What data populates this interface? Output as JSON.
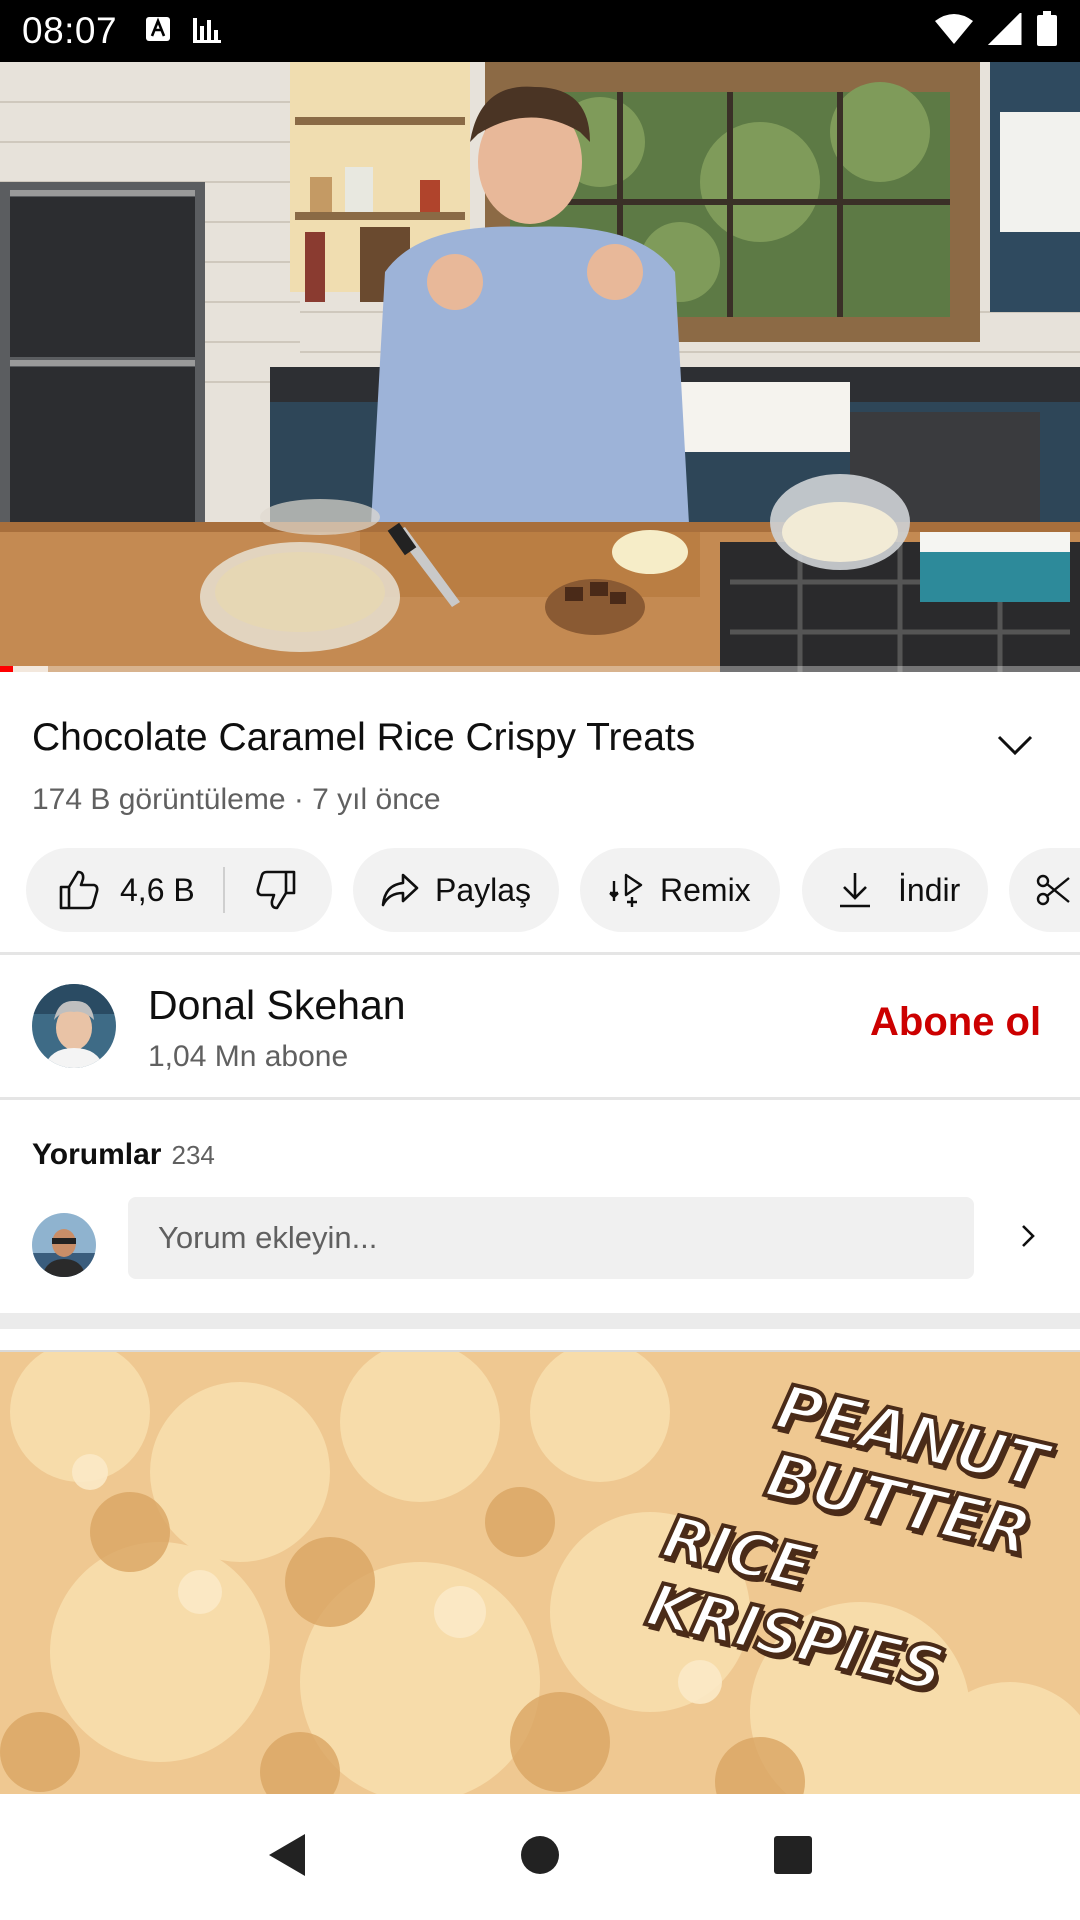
{
  "status_bar": {
    "time": "08:07",
    "icons": [
      "keyboard-a-icon",
      "bar-chart-icon",
      "wifi-icon",
      "signal-icon",
      "battery-icon"
    ]
  },
  "player": {
    "progress_played": 0.012,
    "progress_buffered": 0.044
  },
  "video": {
    "title": "Chocolate Caramel Rice Crispy Treats",
    "meta": "174 B görüntüleme · 7 yıl önce"
  },
  "actions": {
    "like_count": "4,6 B",
    "share_label": "Paylaş",
    "remix_label": "Remix",
    "download_label": "İndir"
  },
  "channel": {
    "name": "Donal Skehan",
    "subscribers": "1,04 Mn abone",
    "subscribe_label": "Abone ol"
  },
  "comments": {
    "label": "Yorumlar",
    "count": "234",
    "placeholder": "Yorum ekleyin..."
  },
  "next_video": {
    "thumbnail_text": [
      "PEANUT",
      "BUTTER",
      "RICE KRISPIES"
    ]
  },
  "colors": {
    "accent_red": "#ff0000",
    "subscribe_red": "#cc0000",
    "chip_bg": "#f2f2f2",
    "text_secondary": "#606060"
  }
}
